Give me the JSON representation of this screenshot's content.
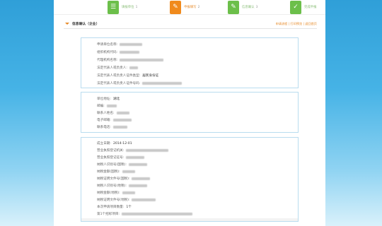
{
  "colors": {
    "accent": "#f08a1d",
    "success": "#6cbf4a",
    "border": "#b9dcef",
    "link": "#2a6fb8"
  },
  "steps": [
    {
      "icon": "checklist-icon",
      "label": "填报单位",
      "num": "1"
    },
    {
      "icon": "edit-icon",
      "label": "申报填写",
      "num": "2"
    },
    {
      "icon": "edit-icon",
      "label": "信息确认",
      "num": "3"
    },
    {
      "icon": "check-icon",
      "label": "完成申报",
      "num": ""
    }
  ],
  "section": {
    "title": "信息确认（企业）",
    "links": "申请流程 | 打印预览 | 返回首页"
  },
  "box1": [
    {
      "k": "申请单位名称:",
      "v": ""
    },
    {
      "k": "组织机构代码:",
      "v": ""
    },
    {
      "k": "代理机构名称:",
      "v": ""
    },
    {
      "k": "法定代表人或负责人:",
      "v": ""
    },
    {
      "k": "法定代表人或负责人证件类型:",
      "v": "居民身份证"
    },
    {
      "k": "法定代表人或负责人证件号码:",
      "v": ""
    }
  ],
  "box2": [
    {
      "k": "单位地址:",
      "v": "湖北"
    },
    {
      "k": "邮编:",
      "v": ""
    },
    {
      "k": "联系人姓名:",
      "v": ""
    },
    {
      "k": "电子邮箱:",
      "v": ""
    },
    {
      "k": "联系电话:",
      "v": ""
    }
  ],
  "box3": [
    {
      "k": "成立日期:",
      "v": "2014-12-01"
    },
    {
      "k": "营业执照登记机关:",
      "v": ""
    },
    {
      "k": "营业执照登记证号:",
      "v": ""
    },
    {
      "k": "纳税人识别号(国税):",
      "v": ""
    },
    {
      "k": "纳税金额(国税):",
      "v": ""
    },
    {
      "k": "纳税证明文件号(国税):",
      "v": ""
    },
    {
      "k": "纳税人识别号(地税):",
      "v": ""
    },
    {
      "k": "纳税金额(地税):",
      "v": ""
    },
    {
      "k": "纳税证明文件号(地税):",
      "v": ""
    },
    {
      "k": "本次申请项目数量:",
      "v": "1个"
    },
    {
      "k": "第1个招标项目:",
      "v": ""
    }
  ]
}
